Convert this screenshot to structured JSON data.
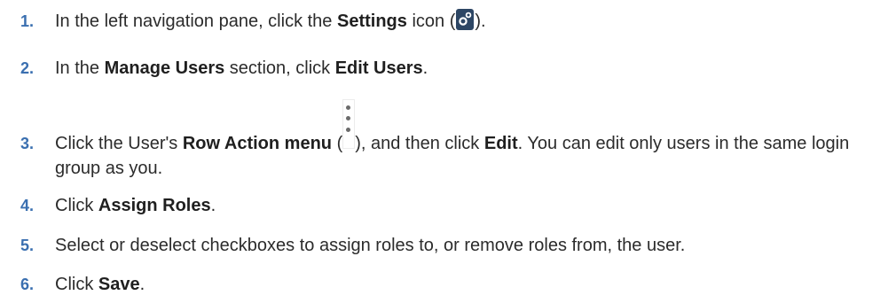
{
  "steps": [
    {
      "number": "1.",
      "parts": [
        "In the left navigation pane, click the ",
        "Settings",
        " icon (",
        ")."
      ]
    },
    {
      "number": "2.",
      "parts": [
        "In the ",
        "Manage Users",
        " section, click ",
        "Edit Users",
        "."
      ]
    },
    {
      "number": "3.",
      "parts": [
        "Click the User's ",
        "Row Action menu",
        " (",
        "), and then click ",
        "Edit",
        ". You can edit only users in the same login group as you."
      ]
    },
    {
      "number": "4.",
      "parts": [
        "Click ",
        "Assign Roles",
        "."
      ]
    },
    {
      "number": "5.",
      "parts": [
        "Select or deselect checkboxes to assign roles to, or remove roles from, the user."
      ]
    },
    {
      "number": "6.",
      "parts": [
        "Click ",
        "Save",
        "."
      ]
    }
  ],
  "icons": {
    "settings": "gear-icon",
    "row_action": "kebab-menu-icon"
  },
  "colors": {
    "step_number": "#3a6fb0",
    "text": "#2b2b2b",
    "icon_bg": "#2d4664"
  }
}
